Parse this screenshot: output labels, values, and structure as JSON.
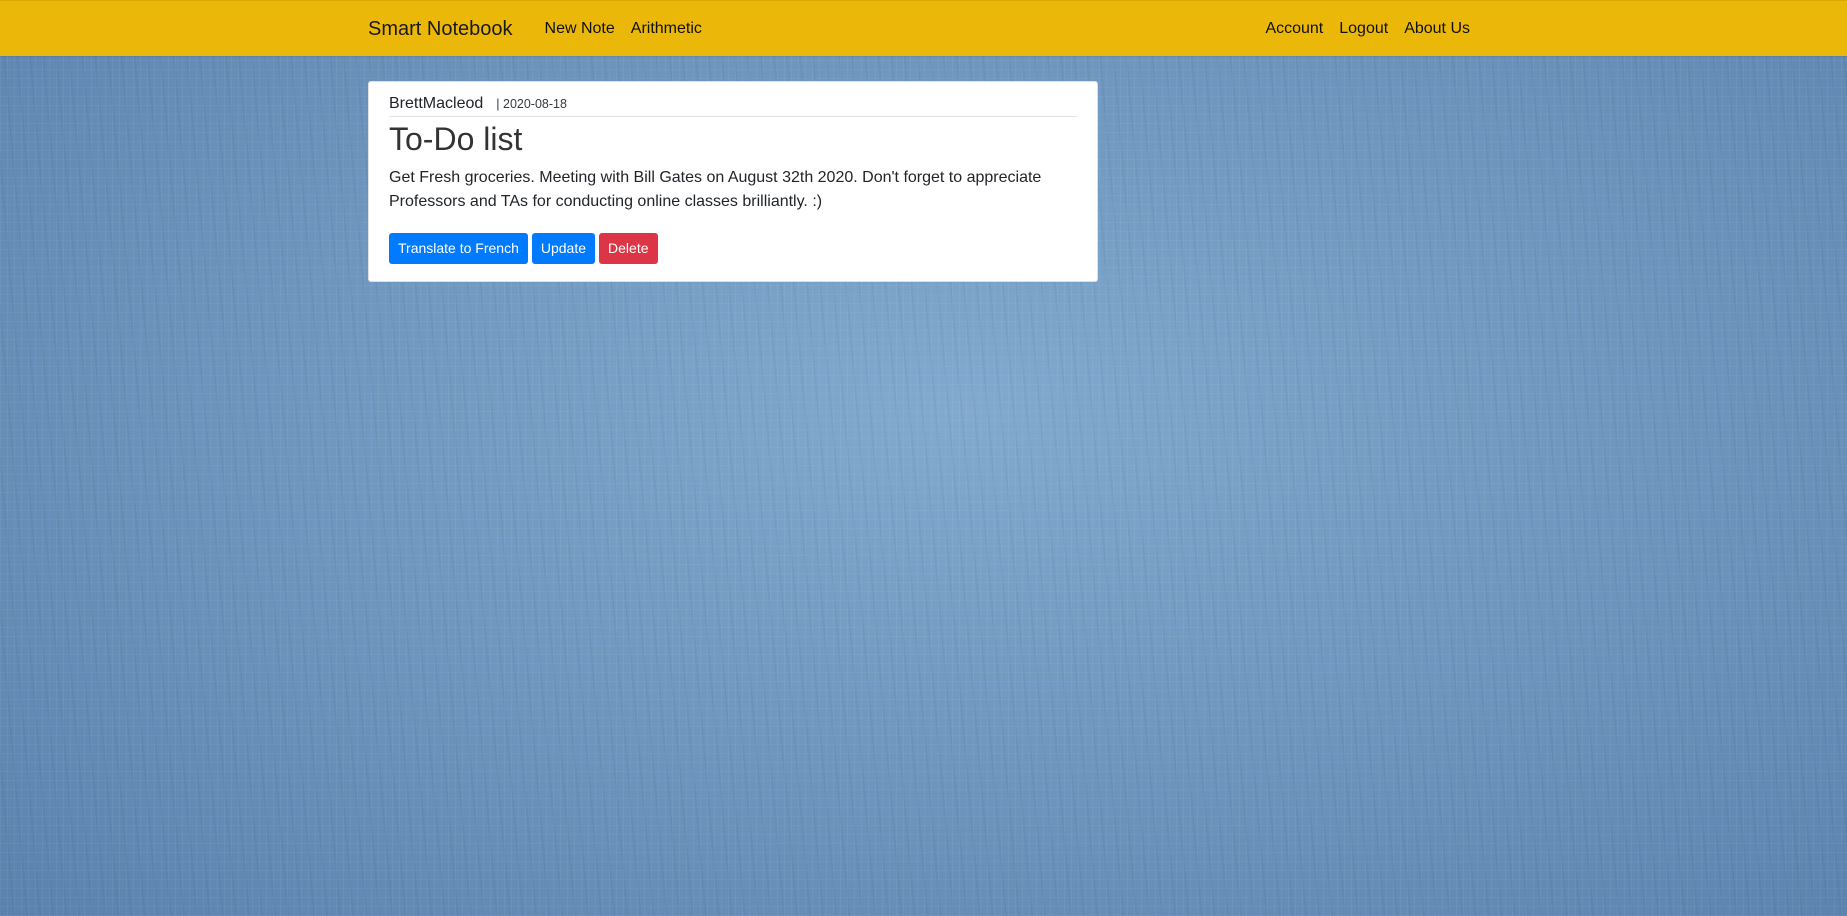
{
  "navbar": {
    "brand": "Smart Notebook",
    "left_links": [
      "New Note",
      "Arithmetic"
    ],
    "right_links": [
      "Account",
      "Logout",
      "About Us"
    ],
    "background_color": "#ebb80a"
  },
  "note": {
    "author": "BrettMacleod",
    "date": "| 2020-08-18",
    "title": "To-Do list",
    "content": "Get Fresh groceries. Meeting with Bill Gates on August 32th 2020. Don't forget to appreciate Professors and TAs for conducting online classes brilliantly. :)",
    "buttons": {
      "translate": "Translate to French",
      "update": "Update",
      "delete": "Delete"
    }
  },
  "colors": {
    "primary": "#007bff",
    "danger": "#dc3545",
    "background": "#6f97bf"
  }
}
